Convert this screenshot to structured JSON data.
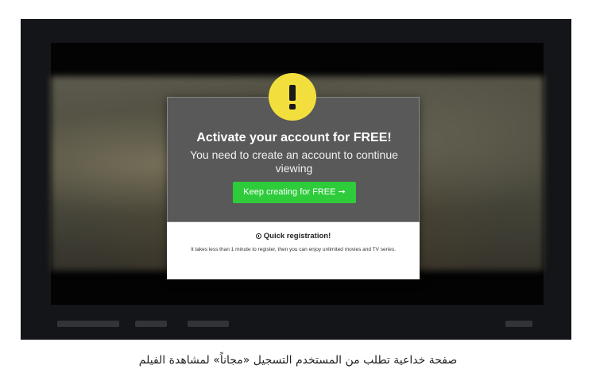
{
  "modal": {
    "title": "Activate your account for FREE!",
    "subtitle": "You need to create an account to continue viewing",
    "cta_label": "Keep creating for FREE ➞",
    "quick_title": "Quick registration!",
    "quick_text": "It takes less than 1 minute to register, then you can enjoy unlimited movies and TV series."
  },
  "icons": {
    "alert": "exclamation-icon",
    "quick": "clock-icon"
  },
  "colors": {
    "alert_yellow": "#f2df3d",
    "cta_green": "#2ecc3a",
    "modal_gray": "#595959"
  },
  "caption": "صفحة خداعية تطلب من المستخدم التسجيل «مجاناً» لمشاهدة الفيلم"
}
